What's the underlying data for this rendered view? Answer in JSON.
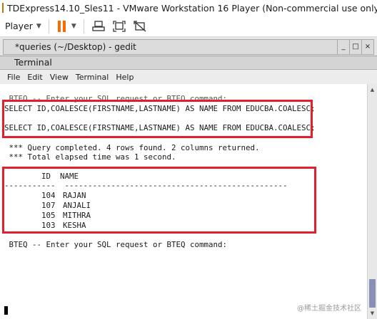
{
  "vmware": {
    "title": "TDExpress14.10_Sles11 - VMware Workstation 16 Player (Non-commercial use only)",
    "player_menu": "Player",
    "toolbar_icons": [
      "pause-icon",
      "send-ctrl-alt-del-icon",
      "fit-guest-icon",
      "unity-icon"
    ],
    "accent_color": "#ff6a00"
  },
  "gedit": {
    "tab_title": "*queries (~/Desktop) - gedit",
    "window_buttons": [
      "_",
      "□",
      "×"
    ]
  },
  "terminal": {
    "title": "Terminal",
    "menu": [
      "File",
      "Edit",
      "View",
      "Terminal",
      "Help"
    ],
    "lines": {
      "prompt_partial": " BTEQ -- Enter your SQL request or BTEQ command:",
      "query1": "SELECT ID,COALESCE(FIRSTNAME,LASTNAME) AS NAME FROM EDUCBA.COALESC;",
      "query2": "SELECT ID,COALESCE(FIRSTNAME,LASTNAME) AS NAME FROM EDUCBA.COALESC;",
      "status1": " *** Query completed. 4 rows found. 2 columns returned.",
      "status2": " *** Total elapsed time was 1 second.",
      "header": "        ID  NAME",
      "separator": "-----------  ------------------------------------------------",
      "prompt": " BTEQ -- Enter your SQL request or BTEQ command:"
    },
    "rows": [
      {
        "id": "104",
        "name": "RAJAN"
      },
      {
        "id": "107",
        "name": "ANJALI"
      },
      {
        "id": "105",
        "name": "MITHRA"
      },
      {
        "id": "103",
        "name": "KESHA"
      }
    ],
    "highlight_color": "#e0202c"
  },
  "watermark": "@稀土掘金技术社区"
}
